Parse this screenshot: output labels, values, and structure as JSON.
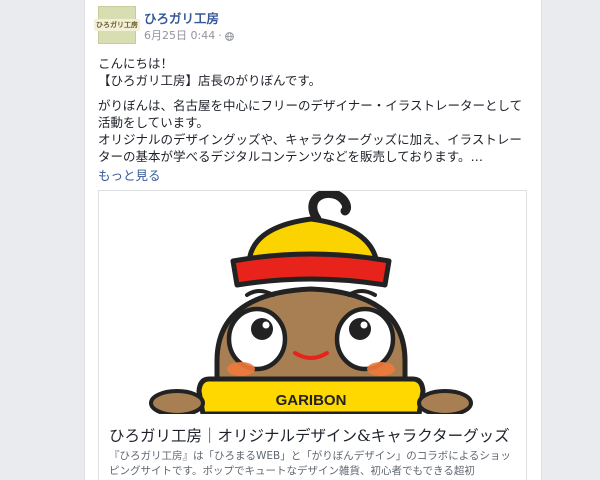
{
  "post": {
    "page_name": "ひろガリ工房",
    "avatar_label": "ひろガリ工房",
    "date": "6月25日 0:44",
    "separator": "·",
    "privacy_icon": "globe-icon",
    "paragraph1": "こんにちは！\n【ひろガリ工房】店長のがりぼんです。",
    "paragraph2": "がりぼんは、名古屋を中心にフリーのデザイナー・イラストレーターとして活動をしています。\nオリジナルのデザイングッズや、キャラクターグッズに加え、イラストレーターの基本が学べるデジタルコンテンツなどを販売しております。…",
    "see_more": "もっと見る"
  },
  "link_preview": {
    "character_bowl_text": "GARIBON",
    "title": "ひろガリ工房｜オリジナルデザイン&キャラクターグッズ",
    "description": "『ひろガリ工房』は「ひろまるWEB」と「がりぼんデザイン」のコラボによるショッピングサイトです。ポップでキュートなデザイン雑貨、初心者でもできる超初"
  },
  "colors": {
    "link_blue": "#365899",
    "hat_yellow": "#fbd300",
    "hat_red": "#e8231c",
    "face_brown": "#a87f52",
    "bowl_yellow": "#ffd800"
  }
}
